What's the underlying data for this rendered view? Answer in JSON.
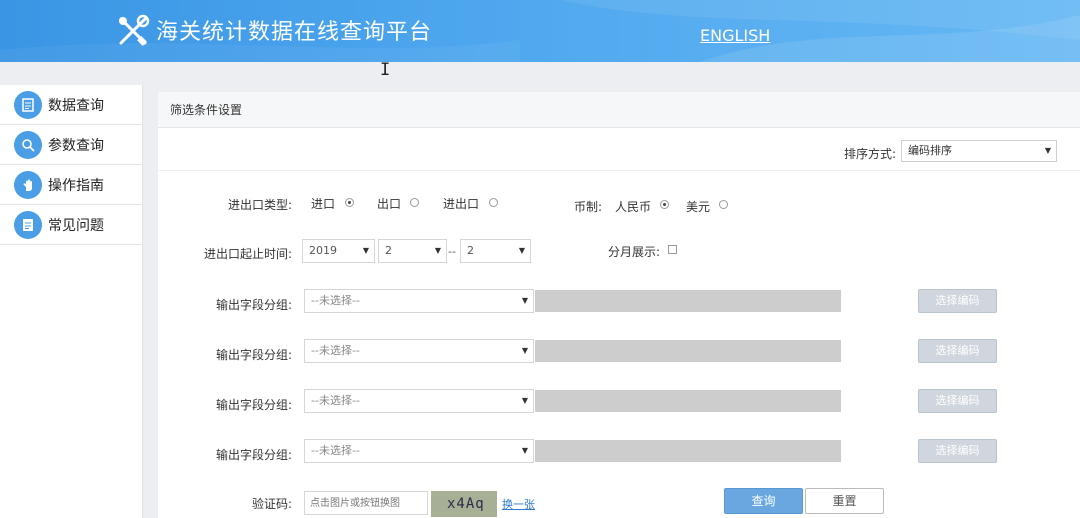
{
  "header": {
    "title": "海关统计数据在线查询平台",
    "english_link": "ENGLISH",
    "logo_icon": "tools-logo-icon"
  },
  "sidebar": {
    "items": [
      {
        "label": "数据查询",
        "icon": "document-icon"
      },
      {
        "label": "参数查询",
        "icon": "magnifier-icon"
      },
      {
        "label": "操作指南",
        "icon": "hand-icon"
      },
      {
        "label": "常见问题",
        "icon": "faq-document-icon"
      }
    ]
  },
  "panel": {
    "title": "筛选条件设置",
    "sort_label": "排序方式:",
    "sort_value": "编码排序"
  },
  "form": {
    "trade_type_label": "进出口类型:",
    "trade_types": [
      {
        "label": "进口",
        "selected": true
      },
      {
        "label": "出口",
        "selected": false
      },
      {
        "label": "进出口",
        "selected": false
      }
    ],
    "currency_label": "币制:",
    "currencies": [
      {
        "label": "人民币",
        "selected": true
      },
      {
        "label": "美元",
        "selected": false
      }
    ],
    "period_label": "进出口起止时间:",
    "year": "2019",
    "month_from": "2",
    "period_separator": "--",
    "month_to": "2",
    "monthly_label": "分月展示:",
    "monthly_checked": false,
    "field_group_label": "输出字段分组:",
    "field_group_placeholder": "--未选择--",
    "select_code_button": "选择编码",
    "captcha_label": "验证码:",
    "captcha_placeholder": "点击图片或按钮换图",
    "captcha_text": "x4Aq",
    "refresh_link": "换一张",
    "query_button": "查询",
    "reset_button": "重置"
  },
  "colors": {
    "header_blue": "#4ea7ee",
    "primary_button": "#6aa7e0",
    "disabled_button": "#cfd6dd",
    "sidebar_icon": "#4a9ee6"
  }
}
